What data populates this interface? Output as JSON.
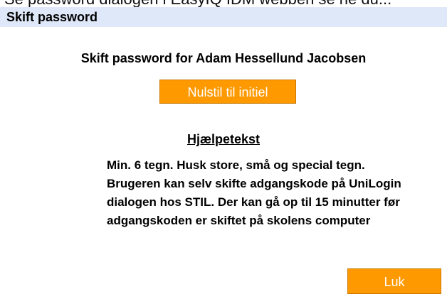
{
  "background_caption": "Se password dialogen i EasyIQ IDM webben se ne du...",
  "dialog": {
    "title": "Skift password",
    "heading": "Skift password for Adam Hessellund Jacobsen",
    "reset_button": "Nulstil til initiel",
    "help_title": "Hjælpetekst",
    "help_lines": [
      "Min. 6 tegn. Husk store, små og special tegn.",
      "Brugeren kan selv skifte adgangskode på UniLogin",
      "dialogen hos STIL. Der kan gå op til 15 minutter før",
      "adgangskoden er skiftet på skolens computer"
    ],
    "close_button": "Luk"
  },
  "colors": {
    "titlebar": "#dfe8f8",
    "accent_button": "#ff9900"
  }
}
